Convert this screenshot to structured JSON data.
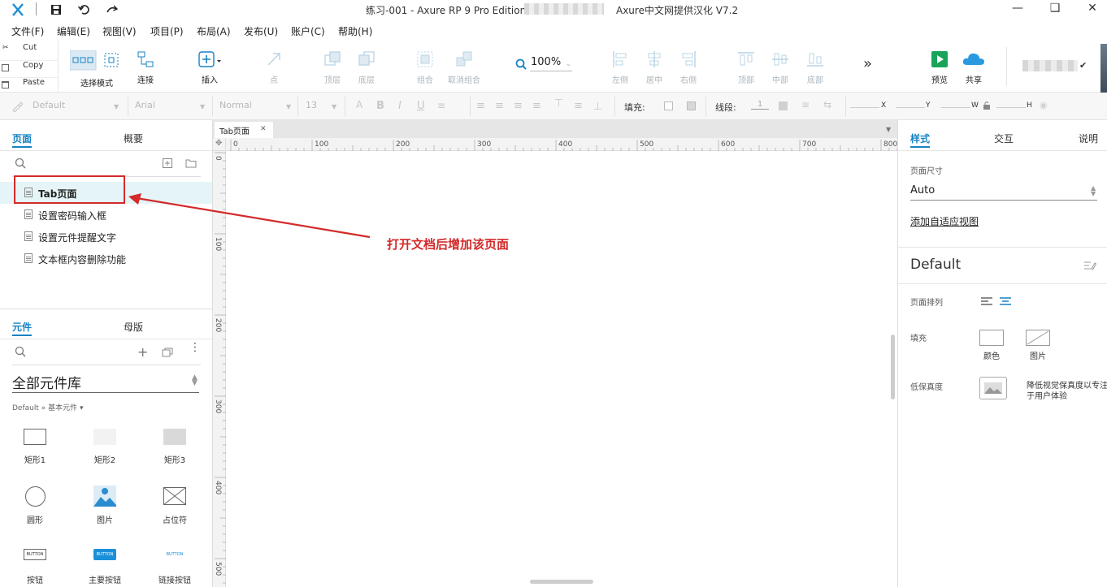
{
  "window": {
    "title": "练习-001 - Axure RP 9 Pro Edition",
    "title_suffix": "Axure中文网提供汉化 V7.2"
  },
  "menu": [
    "文件(F)",
    "编辑(E)",
    "视图(V)",
    "项目(P)",
    "布局(A)",
    "发布(U)",
    "账户(C)",
    "帮助(H)"
  ],
  "clipboard": {
    "cut": "Cut",
    "copy": "Copy",
    "paste": "Paste"
  },
  "toolbar": {
    "select_mode": "选择模式",
    "connect": "连接",
    "insert": "插入",
    "point": "点",
    "top_layer": "顶层",
    "bottom_layer": "底层",
    "group": "组合",
    "ungroup": "取消组合",
    "zoom": "100%",
    "align_left": "左侧",
    "align_center": "居中",
    "align_right": "右侧",
    "align_top": "顶部",
    "align_middle": "中部",
    "align_bottom": "底部",
    "more": "»",
    "preview": "预览",
    "share": "共享"
  },
  "formatbar": {
    "style": "Default",
    "font": "Arial",
    "weight": "Normal",
    "size": "13",
    "fill_label": "填充:",
    "line_label": "线段:",
    "line_width": "1",
    "x": "X",
    "y": "Y",
    "w": "W",
    "h": "H"
  },
  "pages_panel": {
    "tab_pages": "页面",
    "tab_outline": "概要",
    "pages": [
      "Tab页面",
      "设置密码输入框",
      "设置元件提醒文字",
      "文本框内容删除功能"
    ]
  },
  "widgets_panel": {
    "tab_widgets": "元件",
    "tab_masters": "母版",
    "library": "全部元件库",
    "breadcrumb": "Default » 基本元件 ▾",
    "widgets": [
      "矩形1",
      "矩形2",
      "矩形3",
      "圆形",
      "图片",
      "占位符",
      "按钮",
      "主要按钮",
      "链接按钮"
    ],
    "button_text": "BUTTON"
  },
  "canvas": {
    "doc_tab": "Tab页面",
    "h_ticks": [
      "0",
      "100",
      "200",
      "300",
      "400",
      "500",
      "600",
      "700",
      "800"
    ],
    "v_ticks": [
      "0",
      "100",
      "200",
      "300",
      "400",
      "500"
    ]
  },
  "right_panel": {
    "tab_style": "样式",
    "tab_interaction": "交互",
    "tab_notes": "说明",
    "page_size_label": "页面尺寸",
    "page_size_value": "Auto",
    "adaptive_link": "添加自适应视图",
    "style_name": "Default",
    "page_align_label": "页面排列",
    "fill_label": "填充",
    "fill_color": "颜色",
    "fill_image": "图片",
    "low_fidelity_label": "低保真度",
    "low_fidelity_desc_1": "降低视觉保真度以专注",
    "low_fidelity_desc_2": "于用户体验"
  },
  "annotation": {
    "text": "打开文档后增加该页面"
  },
  "colors": {
    "accent": "#1782c4",
    "annotation": "#d42a2a",
    "preview_green": "#19a45a",
    "share_blue": "#2a9ae0"
  }
}
